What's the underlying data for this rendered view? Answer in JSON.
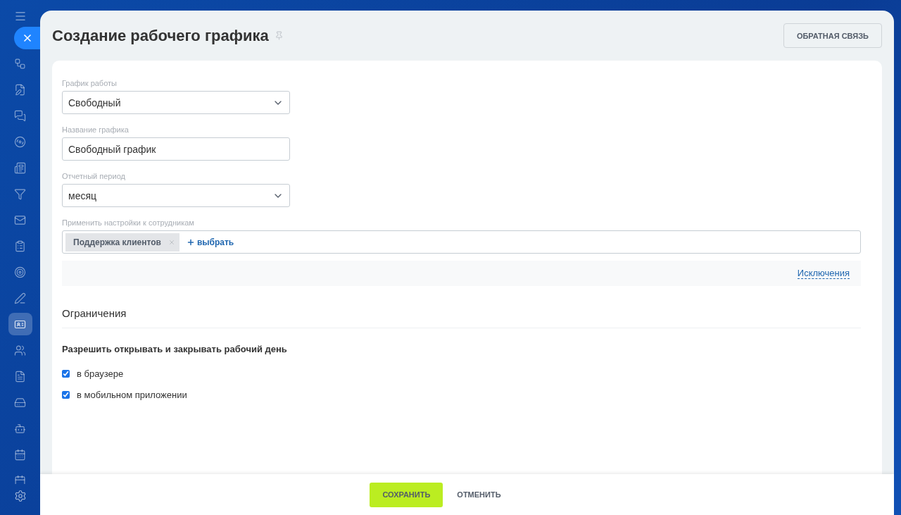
{
  "sidebar": {
    "items": [
      {
        "selected": false
      },
      {
        "selected": false
      },
      {
        "selected": false
      },
      {
        "selected": false
      },
      {
        "selected": false
      },
      {
        "selected": false
      },
      {
        "selected": false
      },
      {
        "selected": false
      },
      {
        "selected": false
      },
      {
        "selected": false
      },
      {
        "selected": true
      },
      {
        "selected": false
      },
      {
        "selected": false
      },
      {
        "selected": false
      },
      {
        "selected": false
      },
      {
        "selected": false
      },
      {
        "selected": false
      }
    ]
  },
  "title": "Создание рабочего графика",
  "feedback_button": "ОБРАТНАЯ СВЯЗЬ",
  "fields": [
    {
      "kind": "select",
      "label": "График работы",
      "value": "Свободный"
    },
    {
      "kind": "input",
      "label": "Название графика",
      "value": "Свободный график"
    },
    {
      "kind": "select",
      "label": "Отчетный период",
      "value": "месяц"
    },
    {
      "kind": "members",
      "label": "Применить настройки к сотрудникам",
      "tags": [
        "Поддержка клиентов"
      ],
      "add": "выбрать"
    }
  ],
  "exceptions_link": "Исключения",
  "section_title": "Ограничения",
  "permission_heading": "Разрешить открывать и закрывать рабочий день",
  "checkboxes": [
    {
      "label": "в браузере",
      "checked": true
    },
    {
      "label": "в мобильном приложении",
      "checked": true
    }
  ],
  "footer": {
    "save": "СОХРАНИТЬ",
    "cancel": "ОТМЕНИТЬ"
  }
}
